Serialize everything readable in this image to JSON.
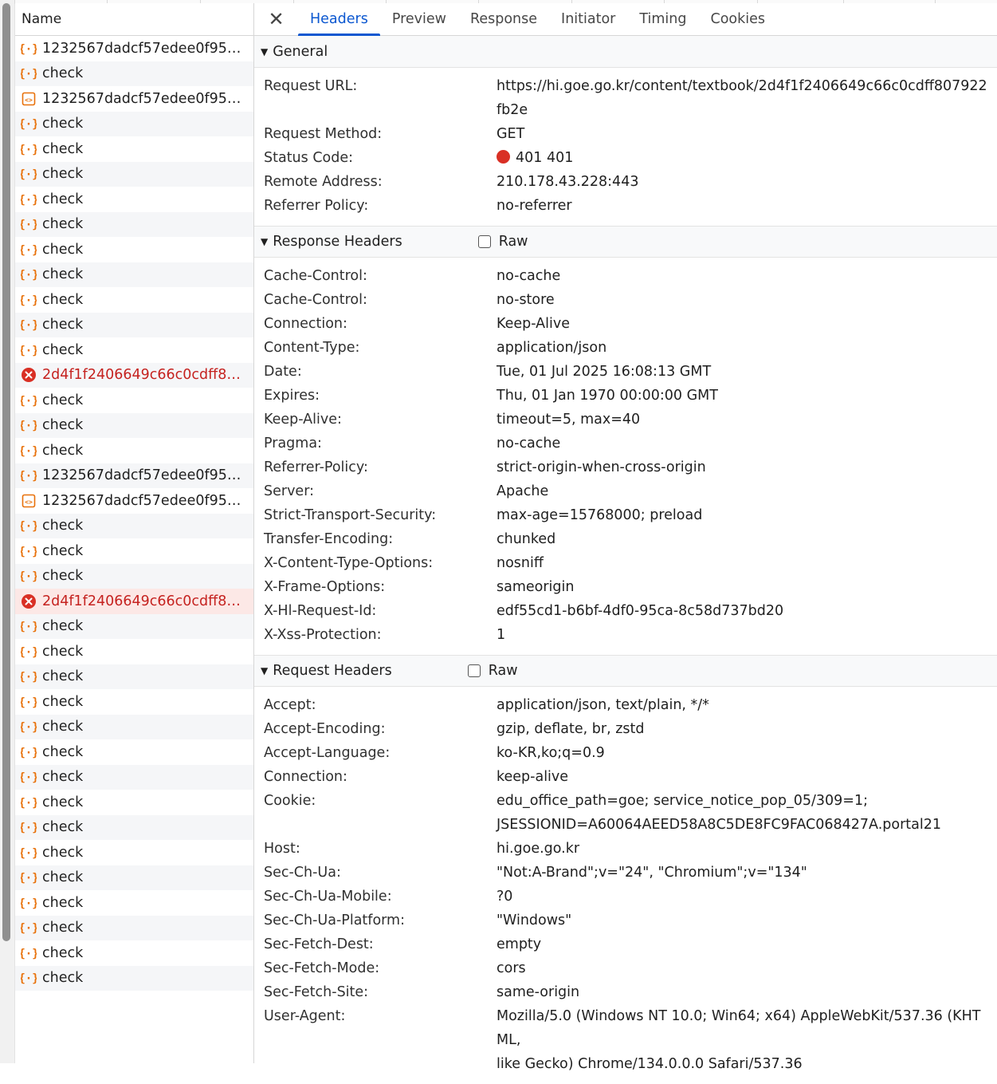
{
  "list": {
    "header": "Name",
    "rows": [
      {
        "label": "1232567dadcf57edee0f95935…",
        "icon": "json-icon",
        "error": false
      },
      {
        "label": "check",
        "icon": "json-icon",
        "error": false
      },
      {
        "label": "1232567dadcf57edee0f95935…",
        "icon": "document-icon",
        "error": false
      },
      {
        "label": "check",
        "icon": "json-icon",
        "error": false
      },
      {
        "label": "check",
        "icon": "json-icon",
        "error": false
      },
      {
        "label": "check",
        "icon": "json-icon",
        "error": false
      },
      {
        "label": "check",
        "icon": "json-icon",
        "error": false
      },
      {
        "label": "check",
        "icon": "json-icon",
        "error": false
      },
      {
        "label": "check",
        "icon": "json-icon",
        "error": false
      },
      {
        "label": "check",
        "icon": "json-icon",
        "error": false
      },
      {
        "label": "check",
        "icon": "json-icon",
        "error": false
      },
      {
        "label": "check",
        "icon": "json-icon",
        "error": false
      },
      {
        "label": "check",
        "icon": "json-icon",
        "error": false
      },
      {
        "label": "2d4f1f2406649c66c0cdff8079…",
        "icon": "error-icon",
        "error": true
      },
      {
        "label": "check",
        "icon": "json-icon",
        "error": false
      },
      {
        "label": "check",
        "icon": "json-icon",
        "error": false
      },
      {
        "label": "check",
        "icon": "json-icon",
        "error": false
      },
      {
        "label": "1232567dadcf57edee0f95935…",
        "icon": "json-icon",
        "error": false
      },
      {
        "label": "1232567dadcf57edee0f95935…",
        "icon": "document-icon",
        "error": false
      },
      {
        "label": "check",
        "icon": "json-icon",
        "error": false
      },
      {
        "label": "check",
        "icon": "json-icon",
        "error": false
      },
      {
        "label": "check",
        "icon": "json-icon",
        "error": false
      },
      {
        "label": "2d4f1f2406649c66c0cdff8079…",
        "icon": "error-icon",
        "error": true,
        "selected": true
      },
      {
        "label": "check",
        "icon": "json-icon",
        "error": false
      },
      {
        "label": "check",
        "icon": "json-icon",
        "error": false
      },
      {
        "label": "check",
        "icon": "json-icon",
        "error": false
      },
      {
        "label": "check",
        "icon": "json-icon",
        "error": false
      },
      {
        "label": "check",
        "icon": "json-icon",
        "error": false
      },
      {
        "label": "check",
        "icon": "json-icon",
        "error": false
      },
      {
        "label": "check",
        "icon": "json-icon",
        "error": false
      },
      {
        "label": "check",
        "icon": "json-icon",
        "error": false
      },
      {
        "label": "check",
        "icon": "json-icon",
        "error": false
      },
      {
        "label": "check",
        "icon": "json-icon",
        "error": false
      },
      {
        "label": "check",
        "icon": "json-icon",
        "error": false
      },
      {
        "label": "check",
        "icon": "json-icon",
        "error": false
      },
      {
        "label": "check",
        "icon": "json-icon",
        "error": false
      },
      {
        "label": "check",
        "icon": "json-icon",
        "error": false
      },
      {
        "label": "check",
        "icon": "json-icon",
        "error": false
      }
    ]
  },
  "tabs": [
    {
      "label": "Headers",
      "active": true
    },
    {
      "label": "Preview",
      "active": false
    },
    {
      "label": "Response",
      "active": false
    },
    {
      "label": "Initiator",
      "active": false
    },
    {
      "label": "Timing",
      "active": false
    },
    {
      "label": "Cookies",
      "active": false
    }
  ],
  "sections": [
    {
      "title": "General",
      "raw": false,
      "rows": [
        {
          "k": "Request URL:",
          "v": "https://hi.goe.go.kr/content/textbook/2d4f1f2406649c66c0cdff807922fb2e"
        },
        {
          "k": "Request Method:",
          "v": "GET"
        },
        {
          "k": "Status Code:",
          "v": "401 401",
          "status": true
        },
        {
          "k": "Remote Address:",
          "v": "210.178.43.228:443"
        },
        {
          "k": "Referrer Policy:",
          "v": "no-referrer"
        }
      ]
    },
    {
      "title": "Response Headers",
      "raw": true,
      "raw_label": "Raw",
      "rows": [
        {
          "k": "Cache-Control:",
          "v": "no-cache"
        },
        {
          "k": "Cache-Control:",
          "v": "no-store"
        },
        {
          "k": "Connection:",
          "v": "Keep-Alive"
        },
        {
          "k": "Content-Type:",
          "v": "application/json"
        },
        {
          "k": "Date:",
          "v": "Tue, 01 Jul 2025 16:08:13 GMT"
        },
        {
          "k": "Expires:",
          "v": "Thu, 01 Jan 1970 00:00:00 GMT"
        },
        {
          "k": "Keep-Alive:",
          "v": "timeout=5, max=40"
        },
        {
          "k": "Pragma:",
          "v": "no-cache"
        },
        {
          "k": "Referrer-Policy:",
          "v": "strict-origin-when-cross-origin"
        },
        {
          "k": "Server:",
          "v": "Apache"
        },
        {
          "k": "Strict-Transport-Security:",
          "v": "max-age=15768000; preload"
        },
        {
          "k": "Transfer-Encoding:",
          "v": "chunked"
        },
        {
          "k": "X-Content-Type-Options:",
          "v": "nosniff"
        },
        {
          "k": "X-Frame-Options:",
          "v": "sameorigin"
        },
        {
          "k": "X-Hl-Request-Id:",
          "v": "edf55cd1-b6bf-4df0-95ca-8c58d737bd20"
        },
        {
          "k": "X-Xss-Protection:",
          "v": "1"
        }
      ]
    },
    {
      "title": "Request Headers",
      "raw": true,
      "raw_label": "Raw",
      "rows": [
        {
          "k": "Accept:",
          "v": "application/json, text/plain, */*"
        },
        {
          "k": "Accept-Encoding:",
          "v": "gzip, deflate, br, zstd"
        },
        {
          "k": "Accept-Language:",
          "v": "ko-KR,ko;q=0.9"
        },
        {
          "k": "Connection:",
          "v": "keep-alive"
        },
        {
          "k": "Cookie:",
          "v": "edu_office_path=goe; service_notice_pop_05/309=1;\nJSESSIONID=A60064AEED58A8C5DE8FC9FAC068427A.portal21"
        },
        {
          "k": "Host:",
          "v": "hi.goe.go.kr"
        },
        {
          "k": "Sec-Ch-Ua:",
          "v": "\"Not:A-Brand\";v=\"24\", \"Chromium\";v=\"134\""
        },
        {
          "k": "Sec-Ch-Ua-Mobile:",
          "v": "?0"
        },
        {
          "k": "Sec-Ch-Ua-Platform:",
          "v": "\"Windows\""
        },
        {
          "k": "Sec-Fetch-Dest:",
          "v": "empty"
        },
        {
          "k": "Sec-Fetch-Mode:",
          "v": "cors"
        },
        {
          "k": "Sec-Fetch-Site:",
          "v": "same-origin"
        },
        {
          "k": "User-Agent:",
          "v": "Mozilla/5.0 (Windows NT 10.0; Win64; x64) AppleWebKit/537.36 (KHTML,\nlike Gecko) Chrome/134.0.0.0 Safari/537.36"
        }
      ]
    }
  ],
  "colors": {
    "accent": "#0b57d0",
    "error": "#c5221f",
    "status_dot": "#d93025",
    "json_icon": "#e8710a"
  }
}
